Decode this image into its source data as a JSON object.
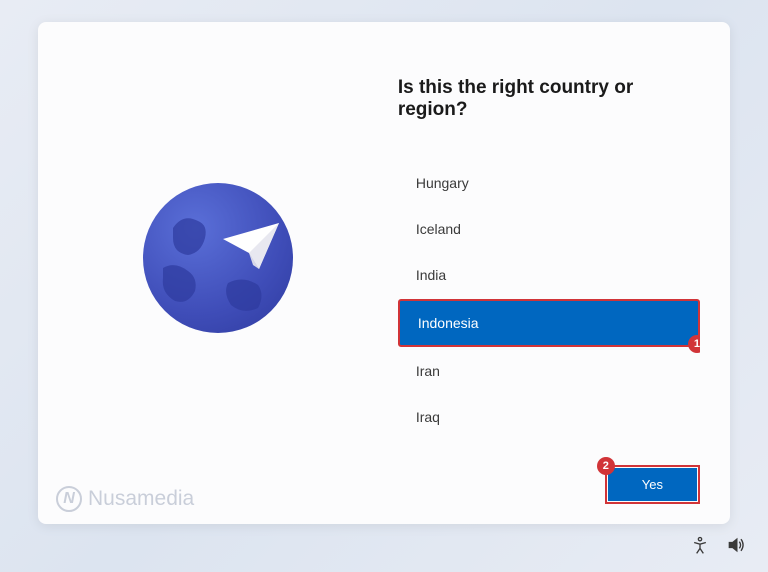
{
  "heading": "Is this the right country or region?",
  "countries": [
    {
      "label": "Hungary",
      "selected": false
    },
    {
      "label": "Iceland",
      "selected": false
    },
    {
      "label": "India",
      "selected": false
    },
    {
      "label": "Indonesia",
      "selected": true
    },
    {
      "label": "Iran",
      "selected": false
    },
    {
      "label": "Iraq",
      "selected": false
    }
  ],
  "button": {
    "yes": "Yes"
  },
  "annotations": {
    "marker1": "1",
    "marker2": "2"
  },
  "watermark": {
    "icon_letter": "N",
    "text": "Nusamedia"
  },
  "colors": {
    "accent": "#0067c0",
    "highlight_border": "#d13438"
  }
}
